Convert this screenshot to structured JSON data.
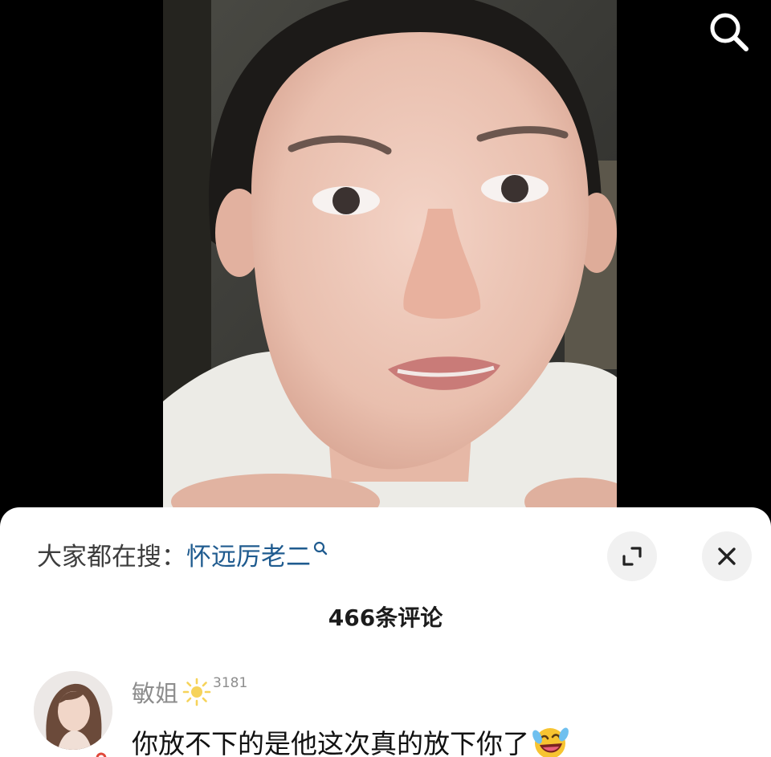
{
  "search": {
    "icon": "search-icon"
  },
  "video": {
    "subject": "video-frame"
  },
  "suggest": {
    "label": "大家都在搜：",
    "term": "怀远厉老二",
    "icon": "search-small-icon",
    "term_color": "#1f5b8f"
  },
  "controls": {
    "expand_icon": "expand-icon",
    "close_icon": "close-icon"
  },
  "comments": {
    "count_text": "466条评论",
    "items": [
      {
        "username": "敏姐",
        "level_icon": "sun-icon",
        "level_number": "3181",
        "text": "你放不下的是他这次真的放下你了",
        "emoji": "laughing-crying-emoji"
      }
    ]
  }
}
